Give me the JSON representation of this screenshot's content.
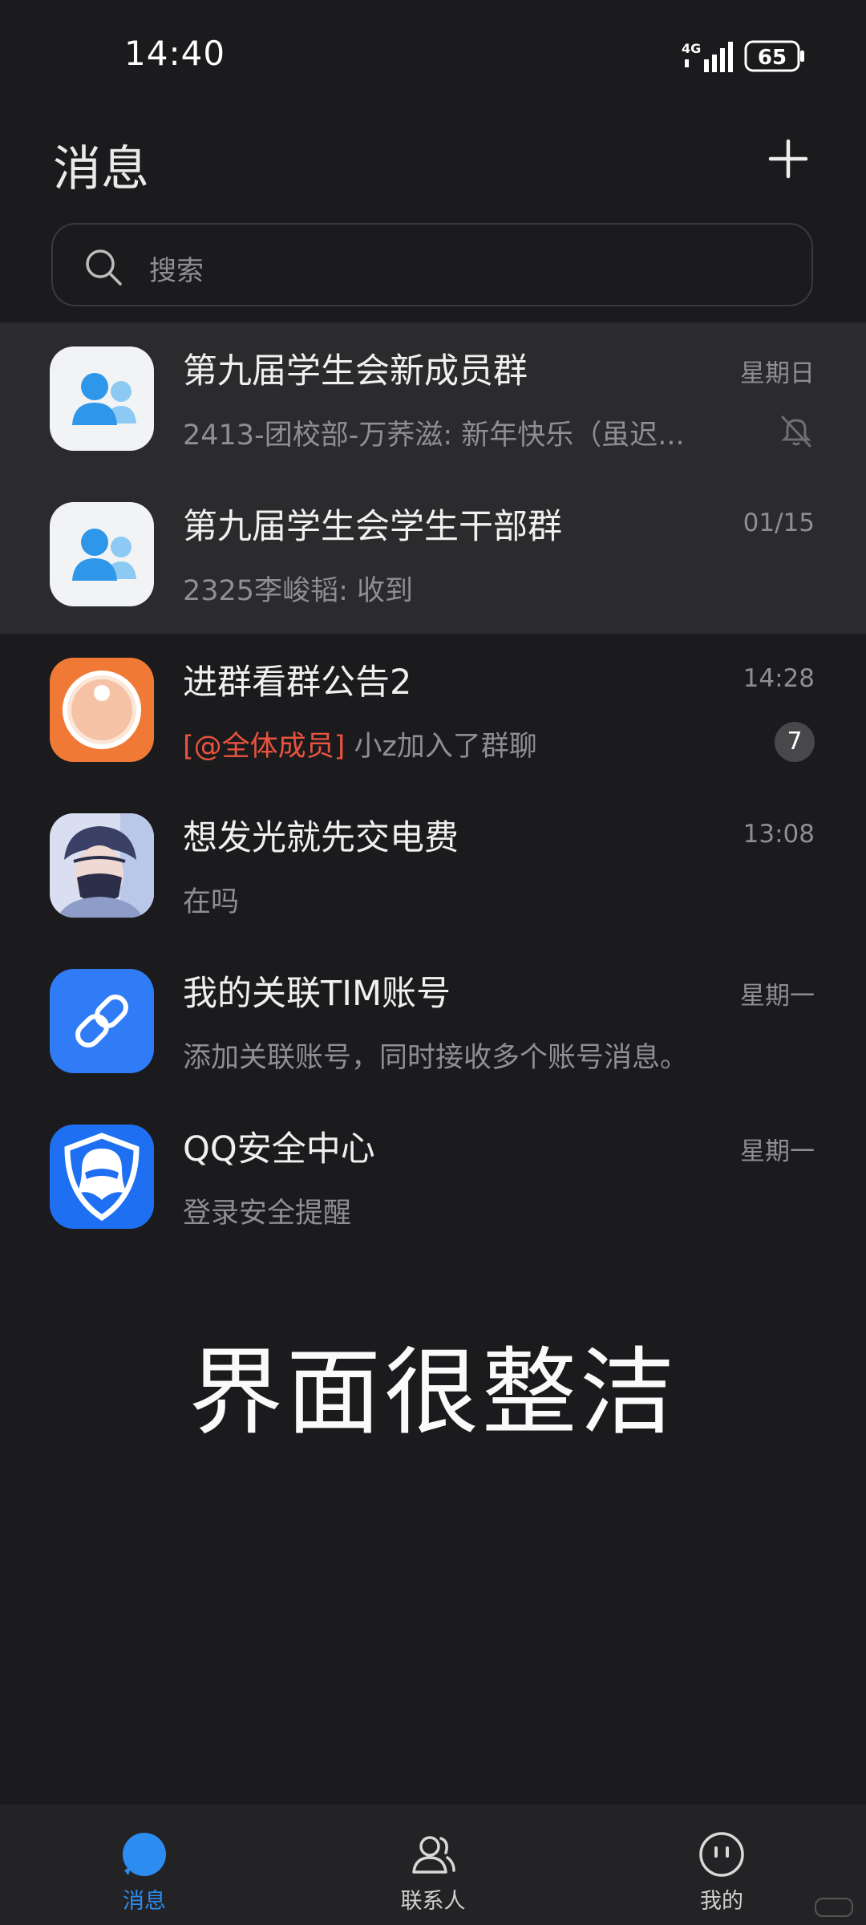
{
  "status": {
    "time": "14:40",
    "network": "4G",
    "battery": "65"
  },
  "header": {
    "title": "消息"
  },
  "search": {
    "placeholder": "搜索"
  },
  "chats": [
    {
      "name": "第九届学生会新成员群",
      "time": "星期日",
      "preview": "2413-团校部-万荞滋: 新年快乐（虽迟...",
      "muted": true,
      "pinned": true
    },
    {
      "name": "第九届学生会学生干部群",
      "time": "01/15",
      "preview": "2325李峻韬: 收到",
      "pinned": true
    },
    {
      "name": "进群看群公告2",
      "time": "14:28",
      "mention": "[@全体成员]",
      "preview": " 小z加入了群聊",
      "badge": "7"
    },
    {
      "name": "想发光就先交电费",
      "time": "13:08",
      "preview": "在吗"
    },
    {
      "name": "我的关联TIM账号",
      "time": "星期一",
      "preview": "添加关联账号，同时接收多个账号消息。"
    },
    {
      "name": "QQ安全中心",
      "time": "星期一",
      "preview": "登录安全提醒"
    }
  ],
  "caption": "界面很整洁",
  "tabs": [
    {
      "label": "消息",
      "active": true
    },
    {
      "label": "联系人"
    },
    {
      "label": "我的"
    }
  ],
  "colors": {
    "accent": "#2d8cf0",
    "mention": "#e9533f",
    "background": "#1b1b1d",
    "pinned": "#2b2b2d"
  },
  "icons": [
    "signal-icon",
    "battery-icon",
    "plus-icon",
    "search-icon",
    "group-icon",
    "camera-lens-icon",
    "link-icon",
    "shield-penguin-icon",
    "mute-bell-icon",
    "chat-bubble-icon",
    "contacts-icon",
    "smiley-icon"
  ]
}
